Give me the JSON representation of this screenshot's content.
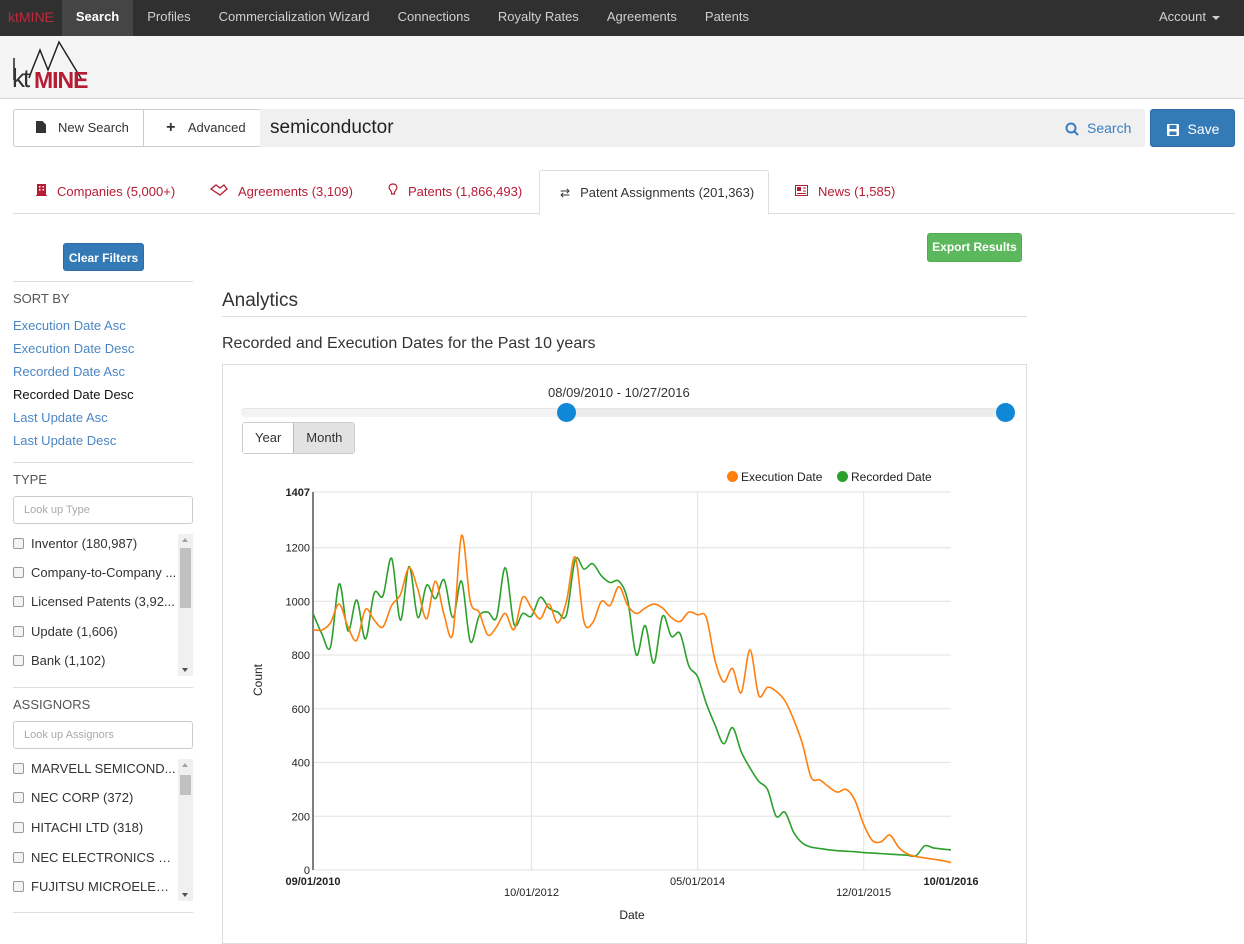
{
  "topnav": {
    "brand": "ktMINE",
    "items": [
      {
        "label": "Search",
        "active": true
      },
      {
        "label": "Profiles"
      },
      {
        "label": "Commercialization Wizard"
      },
      {
        "label": "Connections"
      },
      {
        "label": "Royalty Rates"
      },
      {
        "label": "Agreements"
      },
      {
        "label": "Patents"
      }
    ],
    "account": "Account"
  },
  "logo": {
    "kt": "kt",
    "mine": "MINE"
  },
  "search": {
    "new_search": "New Search",
    "advanced": "Advanced",
    "query": "semiconductor",
    "search_button": "Search",
    "save_button": "Save"
  },
  "tabs": [
    {
      "label": "Companies (5,000+)",
      "icon": "building-icon"
    },
    {
      "label": "Agreements (3,109)",
      "icon": "handshake-icon"
    },
    {
      "label": "Patents (1,866,493)",
      "icon": "lightbulb-icon"
    },
    {
      "label": "Patent Assignments (201,363)",
      "icon": "transfer-icon",
      "active": true
    },
    {
      "label": "News (1,585)",
      "icon": "newspaper-icon"
    }
  ],
  "sidebar": {
    "clear_filters": "Clear Filters",
    "sort_by": {
      "title": "SORT BY",
      "options": [
        {
          "label": "Execution Date Asc"
        },
        {
          "label": "Execution Date Desc"
        },
        {
          "label": "Recorded Date Asc"
        },
        {
          "label": "Recorded Date Desc",
          "active": true
        },
        {
          "label": "Last Update Asc"
        },
        {
          "label": "Last Update Desc"
        }
      ]
    },
    "type": {
      "title": "TYPE",
      "placeholder": "Look up Type",
      "items": [
        {
          "label": "Inventor (180,987)"
        },
        {
          "label": "Company-to-Company ..."
        },
        {
          "label": "Licensed Patents (3,92..."
        },
        {
          "label": "Update (1,606)"
        },
        {
          "label": "Bank (1,102)"
        }
      ]
    },
    "assignors": {
      "title": "ASSIGNORS",
      "placeholder": "Look up Assignors",
      "items": [
        {
          "label": "MARVELL SEMICOND..."
        },
        {
          "label": "NEC CORP (372)"
        },
        {
          "label": "HITACHI LTD (318)"
        },
        {
          "label": "NEC ELECTRONICS C..."
        },
        {
          "label": "FUJITSU MICROELECT..."
        }
      ]
    }
  },
  "main": {
    "export_button": "Export Results",
    "analytics_title": "Analytics",
    "chart_title": "Recorded and Execution Dates for the Past 10 years",
    "range_label": "08/09/2010 - 10/27/2016",
    "range_slider": {
      "min_fraction": 0.425,
      "max_fraction": 1.0
    },
    "granularity": [
      {
        "label": "Year"
      },
      {
        "label": "Month",
        "active": true
      }
    ]
  },
  "chart_data": {
    "type": "line",
    "title": "Recorded and Execution Dates for the Past 10 years",
    "xlabel": "Date",
    "ylabel": "Count",
    "ylim": [
      0,
      1407
    ],
    "yticks": [
      "0",
      "200",
      "400",
      "600",
      "800",
      "1000",
      "1200",
      "1407"
    ],
    "xticks": [
      {
        "label": "09/01/2010",
        "month_index": 0,
        "bold": true
      },
      {
        "label": "10/01/2012",
        "month_index": 25
      },
      {
        "label": "05/01/2014",
        "month_index": 44
      },
      {
        "label": "12/01/2015",
        "month_index": 63
      },
      {
        "label": "10/01/2016",
        "month_index": 73,
        "bold": true
      }
    ],
    "x_start": "09/01/2010",
    "x_end": "10/01/2016",
    "x_unit": "month",
    "grid": true,
    "legend_position": "top-right",
    "series": [
      {
        "name": "Execution Date",
        "color": "#ff7f0e",
        "values": [
          895,
          893,
          920,
          990,
          905,
          855,
          970,
          930,
          905,
          985,
          1025,
          1125,
          1045,
          935,
          1075,
          950,
          880,
          1245,
          1000,
          960,
          875,
          905,
          955,
          895,
          1015,
          975,
          935,
          990,
          920,
          1000,
          1165,
          925,
          920,
          1000,
          985,
          1055,
          985,
          955,
          975,
          990,
          975,
          940,
          925,
          960,
          950,
          940,
          780,
          700,
          750,
          660,
          820,
          650,
          680,
          665,
          630,
          560,
          470,
          345,
          335,
          310,
          290,
          300,
          260,
          170,
          110,
          105,
          130,
          85,
          60,
          50,
          45,
          40,
          35,
          28
        ]
      },
      {
        "name": "Recorded Date",
        "color": "#2ca02c",
        "values": [
          955,
          880,
          830,
          1065,
          890,
          1005,
          860,
          1030,
          1020,
          1160,
          930,
          1130,
          940,
          1060,
          1010,
          1080,
          940,
          1075,
          850,
          945,
          960,
          940,
          1125,
          915,
          955,
          945,
          1015,
          975,
          960,
          950,
          1155,
          1120,
          1140,
          1095,
          1070,
          1075,
          1005,
          800,
          910,
          770,
          945,
          870,
          880,
          760,
          720,
          620,
          540,
          470,
          530,
          440,
          380,
          330,
          300,
          200,
          215,
          140,
          100,
          85,
          80,
          75,
          72,
          70,
          68,
          65,
          63,
          61,
          59,
          57,
          55,
          53,
          90,
          82,
          78,
          75
        ]
      }
    ]
  }
}
